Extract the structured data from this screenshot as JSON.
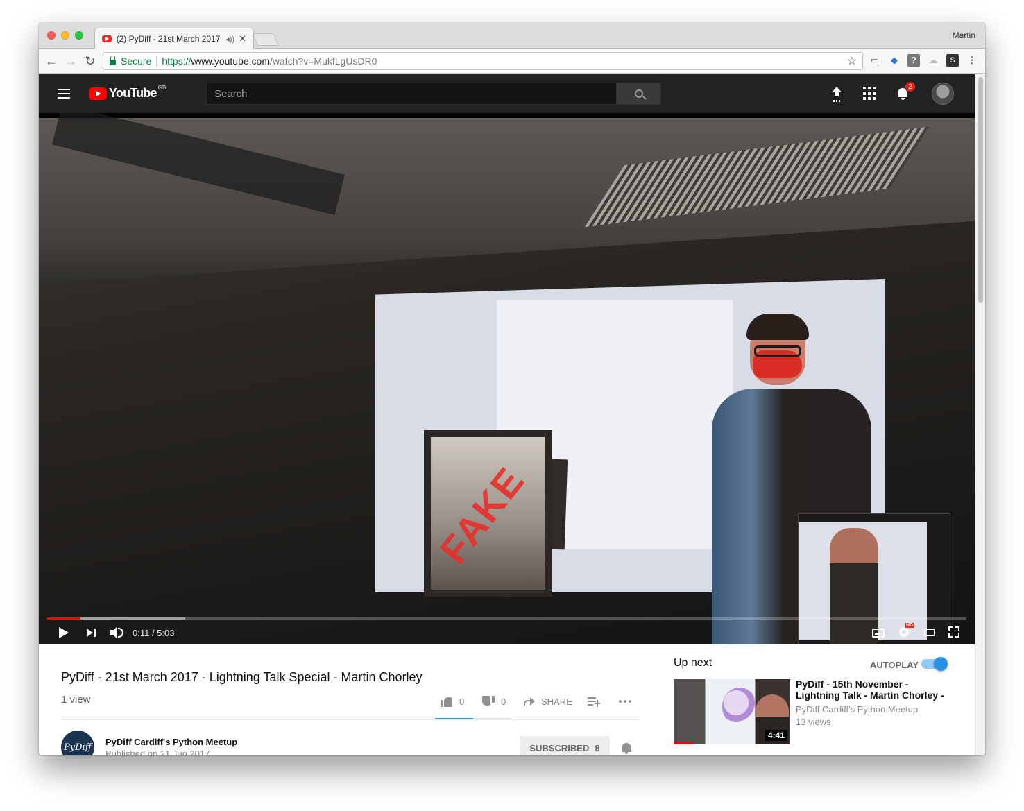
{
  "browser": {
    "tab_title": "(2) PyDiff - 21st March 2017",
    "profile_name": "Martin",
    "security_label": "Secure",
    "url_scheme": "https://",
    "url_host": "www.youtube.com",
    "url_path": "/watch?v=MukfLgUsDR0"
  },
  "youtube": {
    "logo_text": "YouTube",
    "region": "GB",
    "search_placeholder": "Search",
    "notification_count": "2"
  },
  "player": {
    "time_display": "0:11 / 5:03",
    "progress_played": 0.036,
    "progress_loaded": 0.15,
    "overlay_text": "FAKE",
    "hd_badge": "HD"
  },
  "video": {
    "title": "PyDiff - 21st March 2017 - Lightning Talk Special - Martin Chorley",
    "views": "1 view",
    "likes": "0",
    "dislikes": "0",
    "share_label": "SHARE",
    "channel_name": "PyDiff Cardiff's Python Meetup",
    "channel_avatar_text": "PyDiff",
    "published": "Published on 21 Jun 2017",
    "subscribe_label": "SUBSCRIBED",
    "subscriber_count": "8"
  },
  "up_next": {
    "heading": "Up next",
    "autoplay_label": "AUTOPLAY",
    "autoplay_on": true,
    "item": {
      "title": "PyDiff - 15th November - Lightning Talk - Martin Chorley -",
      "channel": "PyDiff Cardiff's Python Meetup",
      "views": "13 views",
      "duration": "4:41"
    }
  }
}
